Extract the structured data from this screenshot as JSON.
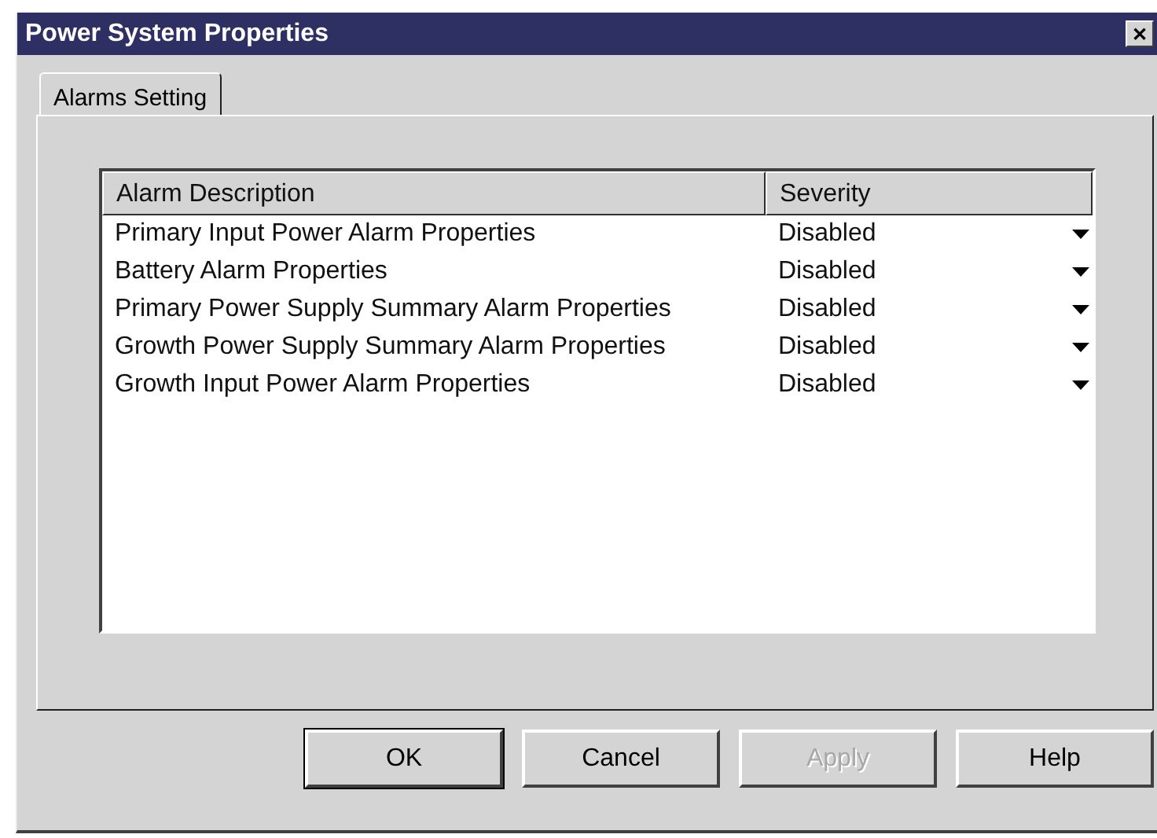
{
  "window": {
    "title": "Power System Properties",
    "close": "✕"
  },
  "tabs": [
    {
      "label": "Alarms Setting",
      "selected": true
    }
  ],
  "table": {
    "columns": [
      "Alarm Description",
      "Severity"
    ],
    "rows": [
      {
        "description": "Primary Input Power Alarm Properties",
        "severity": "Disabled"
      },
      {
        "description": "Battery Alarm Properties",
        "severity": "Disabled"
      },
      {
        "description": "Primary Power Supply Summary Alarm Properties",
        "severity": "Disabled"
      },
      {
        "description": "Growth Power Supply Summary Alarm Properties",
        "severity": "Disabled"
      },
      {
        "description": "Growth Input Power Alarm Properties",
        "severity": "Disabled"
      }
    ]
  },
  "buttons": [
    {
      "label": "OK",
      "default": true,
      "disabled": false
    },
    {
      "label": "Cancel",
      "default": false,
      "disabled": false
    },
    {
      "label": "Apply",
      "default": false,
      "disabled": true
    },
    {
      "label": "Help",
      "default": false,
      "disabled": false
    }
  ]
}
